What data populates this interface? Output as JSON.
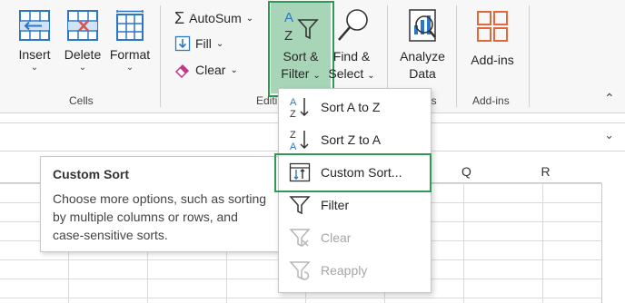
{
  "ribbon": {
    "cells_group": {
      "insert_label": "Insert",
      "delete_label": "Delete",
      "format_label": "Format",
      "caret": "⌄",
      "group_label": "Cells"
    },
    "editing_group": {
      "autosum_label": "AutoSum",
      "autosum_caret": "⌄",
      "fill_label": "Fill",
      "fill_caret": "⌄",
      "clear_label": "Clear",
      "clear_caret": "⌄",
      "sort_filter_line1": "Sort &",
      "sort_filter_line2": "Filter",
      "find_select_line1": "Find &",
      "find_select_line2": "Select",
      "group_label_partial": "Editi"
    },
    "analysis_group": {
      "analyze_line1": "Analyze",
      "analyze_line2": "Data",
      "group_label_partial": "sis"
    },
    "addins_group": {
      "addins_label": "Add-ins",
      "group_label": "Add-ins"
    },
    "collapse_icon": "⌃"
  },
  "formula_bar": {
    "expand_icon": "⌄"
  },
  "column_headers": [
    "Q",
    "R"
  ],
  "tooltip": {
    "title": "Custom Sort",
    "body": "Choose more options, such as sorting by multiple columns or rows, and case-sensitive sorts."
  },
  "sort_menu": {
    "items": [
      {
        "label": "Sort A to Z",
        "enabled": true
      },
      {
        "label": "Sort Z to A",
        "enabled": true
      },
      {
        "label": "Custom Sort...",
        "enabled": true
      },
      {
        "label": "Filter",
        "enabled": true
      },
      {
        "label": "Clear",
        "enabled": false
      },
      {
        "label": "Reapply",
        "enabled": false
      }
    ]
  },
  "colors": {
    "highlight_green": "#2e9a55",
    "sort_filter_pressed": "#a8d5b7",
    "icon_blue": "#2b77c7",
    "icon_red": "#d9534f",
    "addins_orange": "#e2673a",
    "disabled_gray": "#a6a6a6"
  }
}
